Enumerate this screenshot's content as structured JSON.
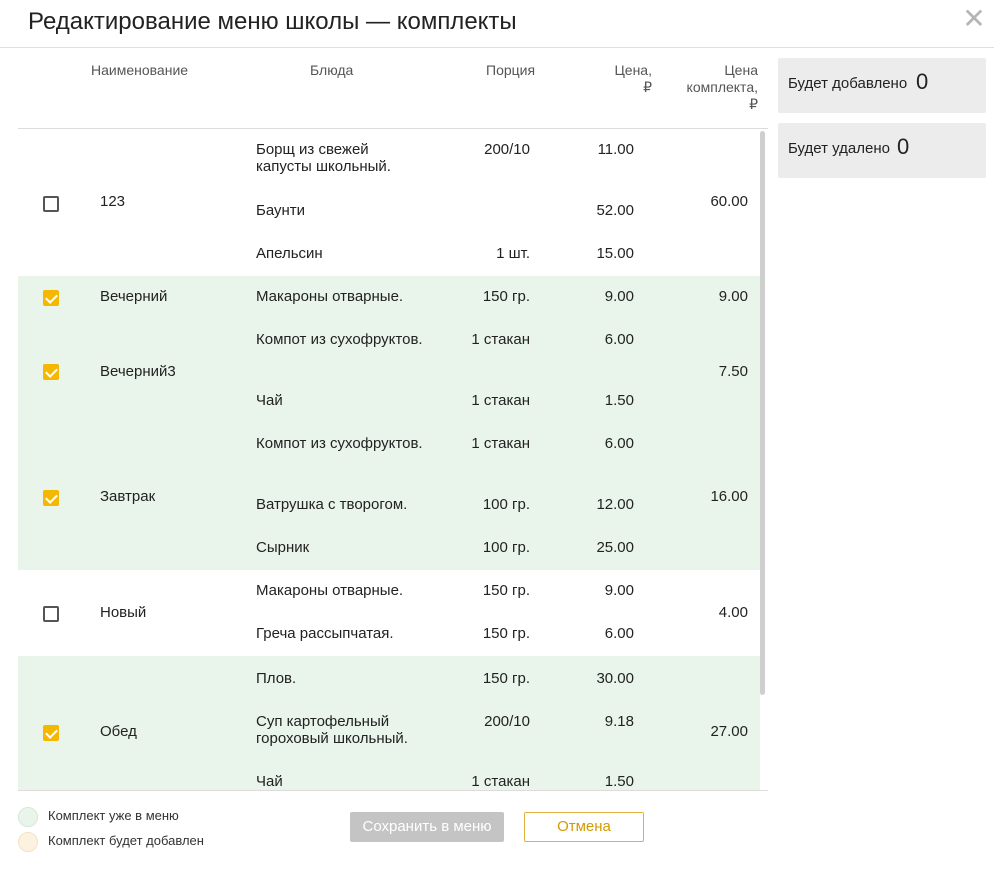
{
  "title": "Редактирование меню школы — комплекты",
  "close_label": "✕",
  "columns": {
    "name": "Наименование",
    "dishes": "Блюда",
    "portion": "Порция",
    "price_line1": "Цена,",
    "price_line2": "₽",
    "kprice_line1": "Цена",
    "kprice_line2": "комплекта,",
    "kprice_line3": "₽"
  },
  "kits": [
    {
      "name": "123",
      "checked": false,
      "price": "60.00",
      "dishes": [
        {
          "name": "Борщ из свежей капусты школьный.",
          "portion": "200/10",
          "price": "11.00"
        },
        {
          "name": "Баунти",
          "portion": "",
          "price": "52.00"
        },
        {
          "name": "Апельсин",
          "portion": "1 шт.",
          "price": "15.00"
        }
      ]
    },
    {
      "name": "Вечерний",
      "checked": true,
      "price": "9.00",
      "dishes": [
        {
          "name": "Макароны отварные.",
          "portion": "150 гр.",
          "price": "9.00"
        }
      ]
    },
    {
      "name": "Вечерний3",
      "checked": true,
      "price": "7.50",
      "dishes": [
        {
          "name": "Компот из сухофруктов.",
          "portion": "1 стакан",
          "price": "6.00"
        },
        {
          "name": "Чай",
          "portion": "1 стакан",
          "price": "1.50"
        }
      ]
    },
    {
      "name": "Завтрак",
      "checked": true,
      "price": "16.00",
      "dishes": [
        {
          "name": "Компот из сухофруктов.",
          "portion": "1 стакан",
          "price": "6.00"
        },
        {
          "name": "Ватрушка с творогом.",
          "portion": "100 гр.",
          "price": "12.00"
        },
        {
          "name": "Сырник",
          "portion": "100 гр.",
          "price": "25.00"
        }
      ]
    },
    {
      "name": "Новый",
      "checked": false,
      "price": "4.00",
      "dishes": [
        {
          "name": "Макароны отварные.",
          "portion": "150 гр.",
          "price": "9.00"
        },
        {
          "name": "Греча рассыпчатая.",
          "portion": "150 гр.",
          "price": "6.00"
        }
      ]
    },
    {
      "name": "Обед",
      "checked": true,
      "price": "27.00",
      "dishes": [
        {
          "name": "Плов.",
          "portion": "150 гр.",
          "price": "30.00"
        },
        {
          "name": "Суп картофельный гороховый школьный.",
          "portion": "200/10",
          "price": "9.18"
        },
        {
          "name": "Чай",
          "portion": "1 стакан",
          "price": "1.50"
        }
      ]
    }
  ],
  "summary": {
    "added_label": "Будет добавлено",
    "added_count": "0",
    "removed_label": "Будет удалено",
    "removed_count": "0"
  },
  "legend": {
    "in_menu": "Комплект уже в меню",
    "will_add": "Комплект будет добавлен"
  },
  "buttons": {
    "save": "Сохранить в меню",
    "cancel": "Отмена"
  },
  "colors": {
    "in_menu_bg": "#e9f5ea",
    "will_add_bg": "#fdf1e0",
    "accent": "#f5b800"
  }
}
